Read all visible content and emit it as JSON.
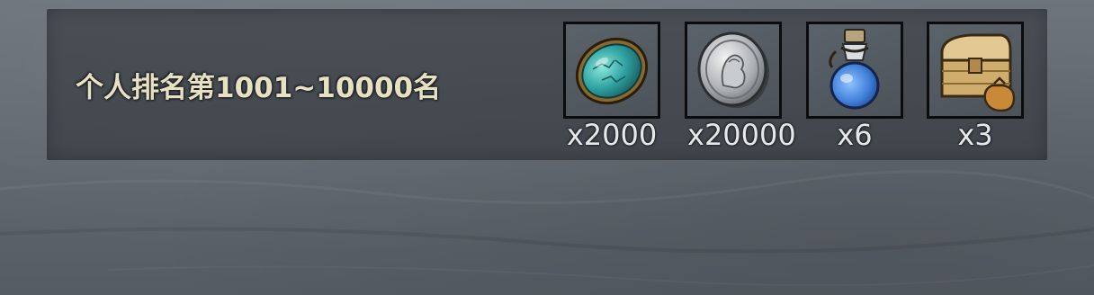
{
  "rank_row": {
    "title": "个人排名第1001~10000名",
    "rewards": [
      {
        "icon": "turquoise-gem-icon",
        "quantity": "x2000"
      },
      {
        "icon": "silver-coin-icon",
        "quantity": "x20000"
      },
      {
        "icon": "blue-potion-icon",
        "quantity": "x6"
      },
      {
        "icon": "treasure-chest-icon",
        "quantity": "x3"
      }
    ]
  },
  "colors": {
    "title_text": "#e7e1c4",
    "quantity_text": "#e6e8ea",
    "slot_border": "#0b0c0d"
  }
}
